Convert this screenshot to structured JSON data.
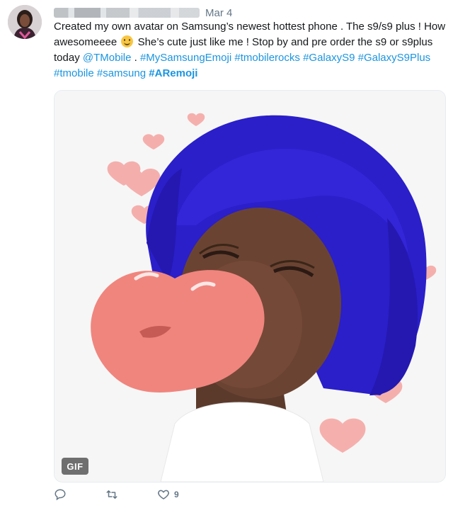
{
  "tweet": {
    "date": "Mar 4",
    "text_parts": [
      {
        "t": "Created my own avatar on Samsung’s newest hottest phone  . The s9/s9 plus ! How awesomeeee "
      },
      {
        "t": " She’s cute just like me ! Stop by and pre order the s9 or s9plus today "
      },
      {
        "t": "@TMobile"
      },
      {
        "t": " . "
      },
      {
        "t": "#MySamsungEmoji"
      },
      {
        "t": " "
      },
      {
        "t": "#tmobilerocks"
      },
      {
        "t": " "
      },
      {
        "t": "#GalaxyS9"
      },
      {
        "t": " "
      },
      {
        "t": "#GalaxyS9Plus"
      },
      {
        "t": " "
      },
      {
        "t": "#tmobile"
      },
      {
        "t": " "
      },
      {
        "t": "#samsung"
      },
      {
        "t": " "
      },
      {
        "t": "#ARemoji"
      }
    ],
    "emoji": "slightly-smiling-face-icon",
    "media": {
      "badge": "GIF"
    },
    "actions": {
      "reply_icon": "reply-icon",
      "retweet_icon": "retweet-icon",
      "like_icon": "heart-icon",
      "like_count": "9"
    }
  },
  "colors": {
    "link": "#1b95e0",
    "text": "#14171a",
    "muted": "#657786",
    "hair": "#2a1fc9",
    "lips": "#f0857e",
    "hearts": "#f4a3a0"
  }
}
